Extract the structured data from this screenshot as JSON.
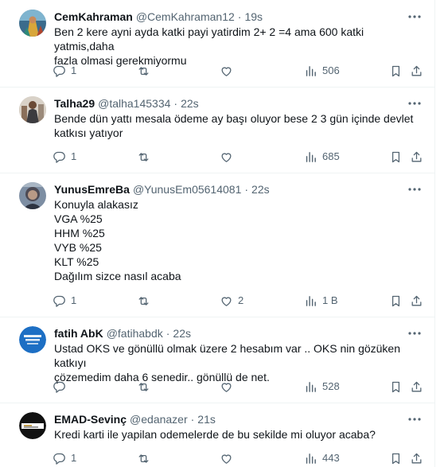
{
  "tweets": [
    {
      "name": "CemKahraman",
      "handle": "@CemKahraman12",
      "time": "19s",
      "lines": [
        "Ben 2 kere ayni ayda katki payi yatirdim 2+ 2 =4 ama 600 katki yatmis,daha",
        "fazla olmasi gerekmiyormu"
      ],
      "replies": "1",
      "retweets": "",
      "likes": "",
      "views": "506",
      "avatar_icon": "avatar-image"
    },
    {
      "name": "Talha29",
      "handle": "@talha145334",
      "time": "22s",
      "lines": [
        "Bende dün yattı mesala ödeme ay başı oluyor bese 2 3 gün içinde devlet",
        "katkısı yatıyor"
      ],
      "replies": "1",
      "retweets": "",
      "likes": "",
      "views": "685",
      "avatar_icon": "avatar-image"
    },
    {
      "name": "YunusEmreBa",
      "handle": "@YunusEm05614081",
      "time": "22s",
      "lines": [
        "Konuyla alakasız",
        "VGA %25",
        "HHM %25",
        "VYB %25",
        "KLT %25",
        "Dağılım sizce nasıl acaba"
      ],
      "replies": "1",
      "retweets": "",
      "likes": "2",
      "views": "1 B",
      "avatar_icon": "avatar-image"
    },
    {
      "name": "fatih AbK",
      "handle": "@fatihabdk",
      "time": "22s",
      "lines": [
        "Ustad OKS ve gönüllü olmak üzere 2 hesabım var .. OKS nin gözüken katkıyı",
        "çözemedim daha 6 senedir.. gönüllü de net."
      ],
      "replies": "",
      "retweets": "",
      "likes": "",
      "views": "528",
      "avatar_icon": "avatar-logo"
    },
    {
      "name": "EMAD-Sevinç",
      "handle": "@edanazer",
      "time": "21s",
      "lines": [
        "Kredi karti ile yapilan odemelerde de bu sekilde mi oluyor acaba?"
      ],
      "replies": "1",
      "retweets": "",
      "likes": "",
      "views": "443",
      "avatar_icon": "avatar-logo"
    }
  ],
  "colors": {
    "text": "#0f1419",
    "secondary": "#536471",
    "divider": "#eff3f4",
    "avatar_blue": "#1d6fc4"
  }
}
